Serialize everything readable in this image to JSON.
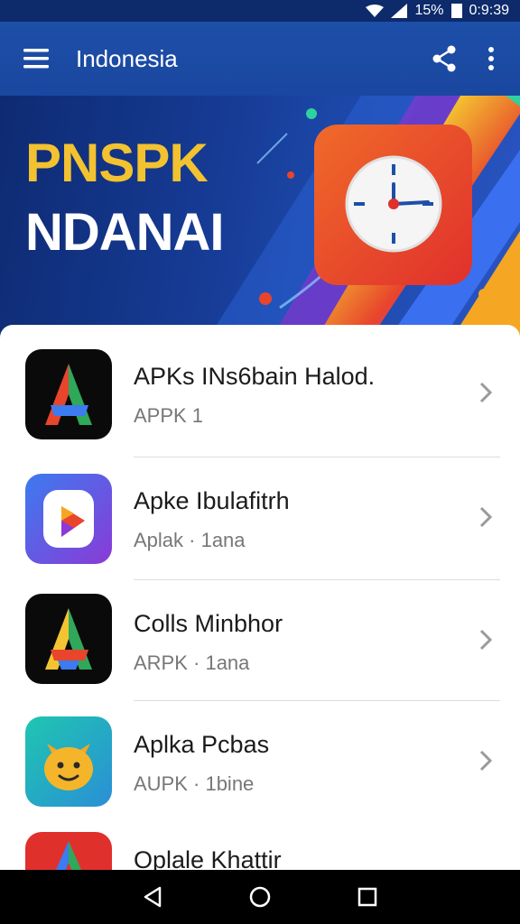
{
  "status_bar": {
    "battery": "15%",
    "time": "0:9:39"
  },
  "app_bar": {
    "title": "Indonesia"
  },
  "banner": {
    "title_line1": "PNSPK",
    "title_line2": "NDANAI"
  },
  "apps": [
    {
      "name": "APKs INs6bain Halod.",
      "subtitle": "APPK 1"
    },
    {
      "name": "Apke Ibulafitrh",
      "subtitle": "Aplak · 1ana"
    },
    {
      "name": "Colls Minbhor",
      "subtitle": "ARPK · 1ana"
    },
    {
      "name": "Aplka Pcbas",
      "subtitle": "AUPK · 1bine"
    },
    {
      "name": "Oplale Khattir",
      "subtitle": ""
    }
  ],
  "colors": {
    "app_bar": "#1d4fa8",
    "banner_accent": "#f2c230",
    "clock_tile": "#e8452c"
  }
}
